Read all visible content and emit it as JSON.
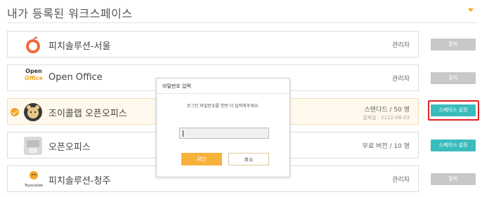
{
  "header": {
    "title": "내가 등록된 워크스페이스"
  },
  "workspaces": [
    {
      "name": "피치솔루션-서울",
      "role": "관리자",
      "action": "탈퇴",
      "action_style": "gray"
    },
    {
      "name": "Open Office",
      "role": "관리자",
      "action": "탈퇴",
      "action_style": "gray",
      "logo_text_top": "Open",
      "logo_text_bottom": "Office"
    },
    {
      "name": "조이콜랩 오픈오피스",
      "plan": "스탠다드 / 50 명",
      "expiry": "결제일 : 2122-06-03",
      "action": "스페이스 설정",
      "action_style": "teal",
      "selected": true
    },
    {
      "name": "오픈오피스",
      "plan": "무료 버전 / 10 명",
      "action": "스페이스 설정",
      "action_style": "teal"
    },
    {
      "name": "피치솔루션-청주",
      "role": "관리자",
      "action": "탈퇴",
      "action_style": "gray",
      "logo_text": "Toyocollab"
    }
  ],
  "modal": {
    "title": "비밀번호 입력",
    "message": "로그인 비밀번호를 한번 더 입력해주세요.",
    "password_value": "",
    "ok_label": "확인",
    "cancel_label": "취소"
  },
  "colors": {
    "accent": "#f5a623",
    "teal": "#3bbcbc",
    "gray_button": "#c8c8c8",
    "highlight": "#e02020"
  }
}
